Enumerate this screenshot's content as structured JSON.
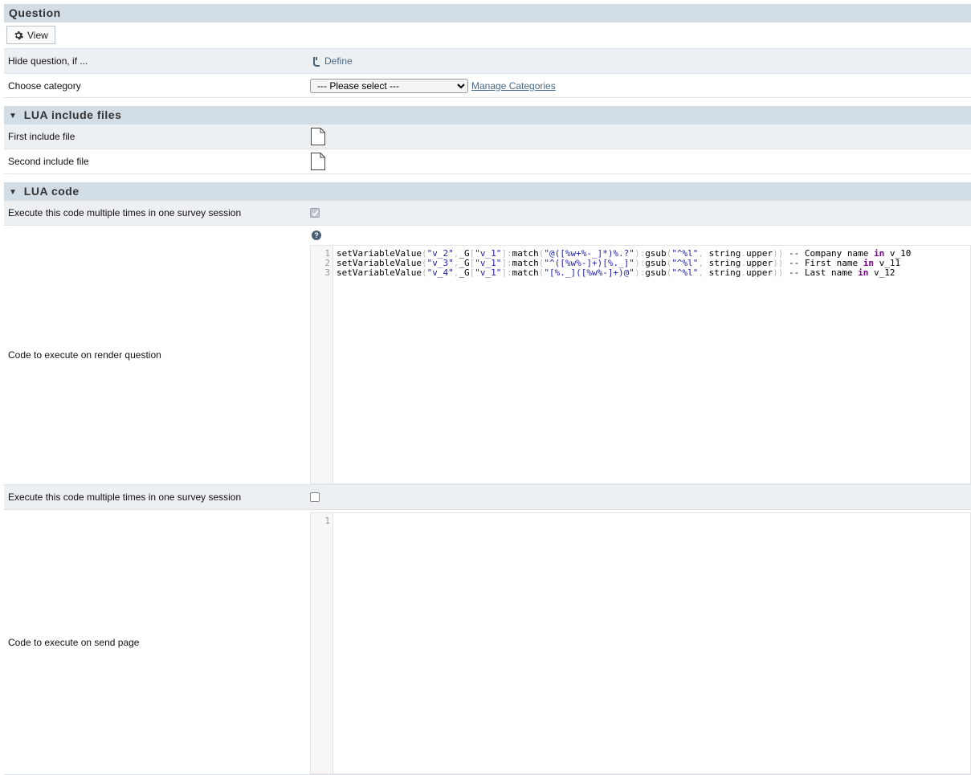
{
  "question": {
    "header": "Question",
    "view_button": "View",
    "hide_label": "Hide question, if ...",
    "define_link": "Define",
    "category_label": "Choose category",
    "category_select": "--- Please select ---",
    "manage_link": "Manage Categories"
  },
  "lua_include": {
    "header": "LUA include files",
    "first_label": "First include file",
    "second_label": "Second include file"
  },
  "lua_code": {
    "header": "LUA code",
    "exec_multi_label_1": "Execute this code multiple times in one survey session",
    "exec_multi_1_checked": true,
    "render_label": "Code to execute on render question",
    "render_code_lines": [
      "setVariableValue(\"v_2\",_G[\"v_1\"]:match(\"@([%w+%-_]*)%.?\"):gsub(\"^%l\", string.upper)) -- Company name in v_10",
      "setVariableValue(\"v_3\",_G[\"v_1\"]:match(\"^([%w%-]+)[%._]\"):gsub(\"^%l\", string.upper)) -- First name in v_11",
      "setVariableValue(\"v_4\",_G[\"v_1\"]:match(\"[%._]([%w%-]+)@\"):gsub(\"^%l\", string.upper)) -- Last name in v_12"
    ],
    "render_line_numbers": [
      "1",
      "2",
      "3"
    ],
    "exec_multi_label_2": "Execute this code multiple times in one survey session",
    "exec_multi_2_checked": false,
    "send_label": "Code to execute on send page",
    "send_line_numbers": [
      "1"
    ]
  },
  "icons": {
    "view": "gear-icon",
    "define": "branch-icon",
    "file": "file-icon",
    "help": "question-circle-icon",
    "collapse": "triangle-down-icon"
  }
}
